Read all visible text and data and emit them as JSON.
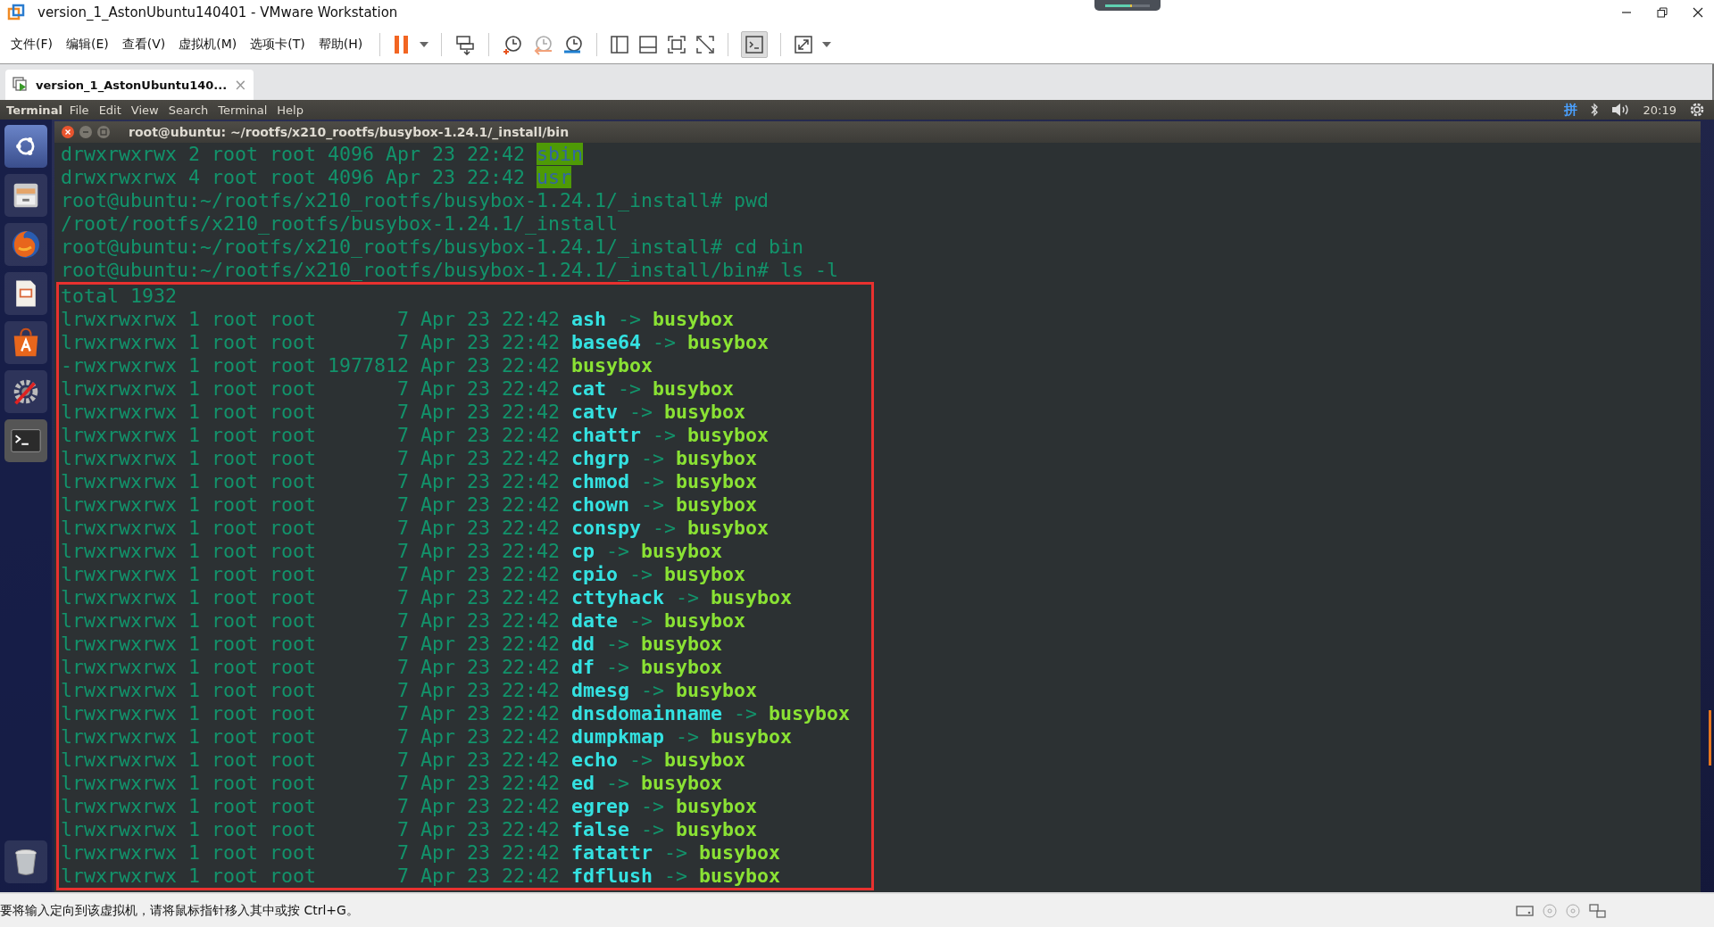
{
  "window": {
    "title": "version_1_AstonUbuntu140401 - VMware Workstation"
  },
  "menu": [
    "文件(F)",
    "编辑(E)",
    "查看(V)",
    "虚拟机(M)",
    "选项卡(T)",
    "帮助(H)"
  ],
  "vm_tab": {
    "label": "version_1_AstonUbuntu140...",
    "close": "×"
  },
  "ubuntu_panel": {
    "app_name": "Terminal",
    "menus": [
      "File",
      "Edit",
      "View",
      "Search",
      "Terminal",
      "Help"
    ],
    "input_method": "拼",
    "clock": "20:19"
  },
  "terminal": {
    "title": "root@ubuntu: ~/rootfs/x210_rootfs/busybox-1.24.1/_install/bin",
    "lines": [
      {
        "kind": "dir",
        "prefix": "drwxrwxrwx 2 root root 4096 Apr 23 22:42 ",
        "name": "sbin"
      },
      {
        "kind": "dir",
        "prefix": "drwxrwxrwx 4 root root 4096 Apr 23 22:42 ",
        "name": "usr"
      },
      {
        "kind": "plain",
        "text": "root@ubuntu:~/rootfs/x210_rootfs/busybox-1.24.1/_install# pwd"
      },
      {
        "kind": "plain",
        "text": "/root/rootfs/x210_rootfs/busybox-1.24.1/_install"
      },
      {
        "kind": "plain",
        "text": "root@ubuntu:~/rootfs/x210_rootfs/busybox-1.24.1/_install# cd bin"
      },
      {
        "kind": "plain",
        "text": "root@ubuntu:~/rootfs/x210_rootfs/busybox-1.24.1/_install/bin# ls -l"
      }
    ],
    "highlighted_lines": [
      {
        "kind": "plain",
        "text": "total 1932"
      },
      {
        "kind": "link",
        "prefix": "lrwxrwxrwx 1 root root       7 Apr 23 22:42 ",
        "name": "ash",
        "arrow": "->",
        "target": "busybox"
      },
      {
        "kind": "link",
        "prefix": "lrwxrwxrwx 1 root root       7 Apr 23 22:42 ",
        "name": "base64",
        "arrow": "->",
        "target": "busybox"
      },
      {
        "kind": "exec",
        "prefix": "-rwxrwxrwx 1 root root 1977812 Apr 23 22:42 ",
        "name": "busybox"
      },
      {
        "kind": "link",
        "prefix": "lrwxrwxrwx 1 root root       7 Apr 23 22:42 ",
        "name": "cat",
        "arrow": "->",
        "target": "busybox"
      },
      {
        "kind": "link",
        "prefix": "lrwxrwxrwx 1 root root       7 Apr 23 22:42 ",
        "name": "catv",
        "arrow": "->",
        "target": "busybox"
      },
      {
        "kind": "link",
        "prefix": "lrwxrwxrwx 1 root root       7 Apr 23 22:42 ",
        "name": "chattr",
        "arrow": "->",
        "target": "busybox"
      },
      {
        "kind": "link",
        "prefix": "lrwxrwxrwx 1 root root       7 Apr 23 22:42 ",
        "name": "chgrp",
        "arrow": "->",
        "target": "busybox"
      },
      {
        "kind": "link",
        "prefix": "lrwxrwxrwx 1 root root       7 Apr 23 22:42 ",
        "name": "chmod",
        "arrow": "->",
        "target": "busybox"
      },
      {
        "kind": "link",
        "prefix": "lrwxrwxrwx 1 root root       7 Apr 23 22:42 ",
        "name": "chown",
        "arrow": "->",
        "target": "busybox"
      },
      {
        "kind": "link",
        "prefix": "lrwxrwxrwx 1 root root       7 Apr 23 22:42 ",
        "name": "conspy",
        "arrow": "->",
        "target": "busybox"
      },
      {
        "kind": "link",
        "prefix": "lrwxrwxrwx 1 root root       7 Apr 23 22:42 ",
        "name": "cp",
        "arrow": "->",
        "target": "busybox"
      },
      {
        "kind": "link",
        "prefix": "lrwxrwxrwx 1 root root       7 Apr 23 22:42 ",
        "name": "cpio",
        "arrow": "->",
        "target": "busybox"
      },
      {
        "kind": "link",
        "prefix": "lrwxrwxrwx 1 root root       7 Apr 23 22:42 ",
        "name": "cttyhack",
        "arrow": "->",
        "target": "busybox"
      },
      {
        "kind": "link",
        "prefix": "lrwxrwxrwx 1 root root       7 Apr 23 22:42 ",
        "name": "date",
        "arrow": "->",
        "target": "busybox"
      },
      {
        "kind": "link",
        "prefix": "lrwxrwxrwx 1 root root       7 Apr 23 22:42 ",
        "name": "dd",
        "arrow": "->",
        "target": "busybox"
      },
      {
        "kind": "link",
        "prefix": "lrwxrwxrwx 1 root root       7 Apr 23 22:42 ",
        "name": "df",
        "arrow": "->",
        "target": "busybox"
      },
      {
        "kind": "link",
        "prefix": "lrwxrwxrwx 1 root root       7 Apr 23 22:42 ",
        "name": "dmesg",
        "arrow": "->",
        "target": "busybox"
      },
      {
        "kind": "link",
        "prefix": "lrwxrwxrwx 1 root root       7 Apr 23 22:42 ",
        "name": "dnsdomainname",
        "arrow": "->",
        "target": "busybox"
      },
      {
        "kind": "link",
        "prefix": "lrwxrwxrwx 1 root root       7 Apr 23 22:42 ",
        "name": "dumpkmap",
        "arrow": "->",
        "target": "busybox"
      },
      {
        "kind": "link",
        "prefix": "lrwxrwxrwx 1 root root       7 Apr 23 22:42 ",
        "name": "echo",
        "arrow": "->",
        "target": "busybox"
      },
      {
        "kind": "link",
        "prefix": "lrwxrwxrwx 1 root root       7 Apr 23 22:42 ",
        "name": "ed",
        "arrow": "->",
        "target": "busybox"
      },
      {
        "kind": "link",
        "prefix": "lrwxrwxrwx 1 root root       7 Apr 23 22:42 ",
        "name": "egrep",
        "arrow": "->",
        "target": "busybox"
      },
      {
        "kind": "link",
        "prefix": "lrwxrwxrwx 1 root root       7 Apr 23 22:42 ",
        "name": "false",
        "arrow": "->",
        "target": "busybox"
      },
      {
        "kind": "link",
        "prefix": "lrwxrwxrwx 1 root root       7 Apr 23 22:42 ",
        "name": "fatattr",
        "arrow": "->",
        "target": "busybox"
      },
      {
        "kind": "link",
        "prefix": "lrwxrwxrwx 1 root root       7 Apr 23 22:42 ",
        "name": "fdflush",
        "arrow": "->",
        "target": "busybox"
      }
    ]
  },
  "status_bar": {
    "message": "要将输入定向到该虚拟机，请将鼠标指针移入其中或按 Ctrl+G。"
  }
}
